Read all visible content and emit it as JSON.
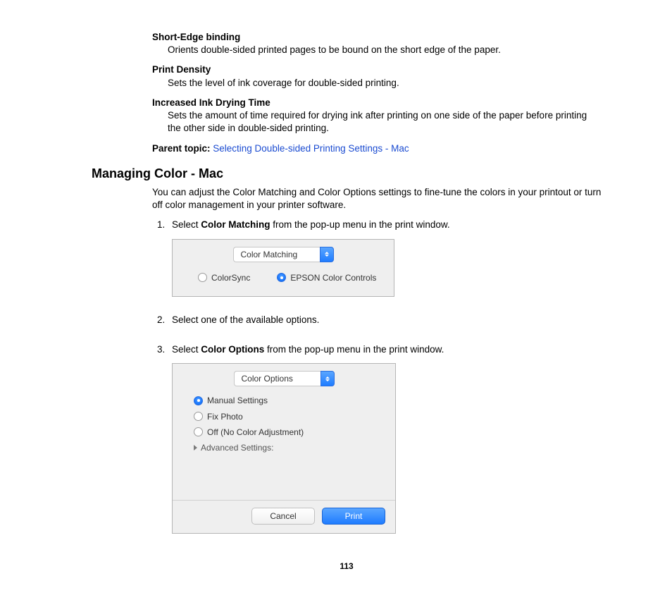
{
  "defs": [
    {
      "term": "Short-Edge binding",
      "body": "Orients double-sided printed pages to be bound on the short edge of the paper."
    },
    {
      "term": "Print Density",
      "body": "Sets the level of ink coverage for double-sided printing."
    },
    {
      "term": "Increased Ink Drying Time",
      "body": "Sets the amount of time required for drying ink after printing on one side of the paper before printing the other side in double-sided printing."
    }
  ],
  "parent_topic": {
    "label": "Parent topic: ",
    "link": "Selecting Double-sided Printing Settings - Mac"
  },
  "section": {
    "title": "Managing Color - Mac",
    "intro": "You can adjust the Color Matching and Color Options settings to fine-tune the colors in your printout or turn off color management in your printer software.",
    "steps": {
      "s1_pre": "Select ",
      "s1_bold": "Color Matching",
      "s1_post": " from the pop-up menu in the print window.",
      "s2": "Select one of the available options.",
      "s3_pre": "Select ",
      "s3_bold": "Color Options",
      "s3_post": " from the pop-up menu in the print window."
    }
  },
  "dialog1": {
    "select_label": "Color Matching",
    "radio1": "ColorSync",
    "radio2": "EPSON Color Controls"
  },
  "dialog2": {
    "select_label": "Color Options",
    "opt1": "Manual Settings",
    "opt2": "Fix Photo",
    "opt3": "Off (No Color Adjustment)",
    "advanced": "Advanced Settings:",
    "cancel": "Cancel",
    "print": "Print"
  },
  "page_number": "113"
}
